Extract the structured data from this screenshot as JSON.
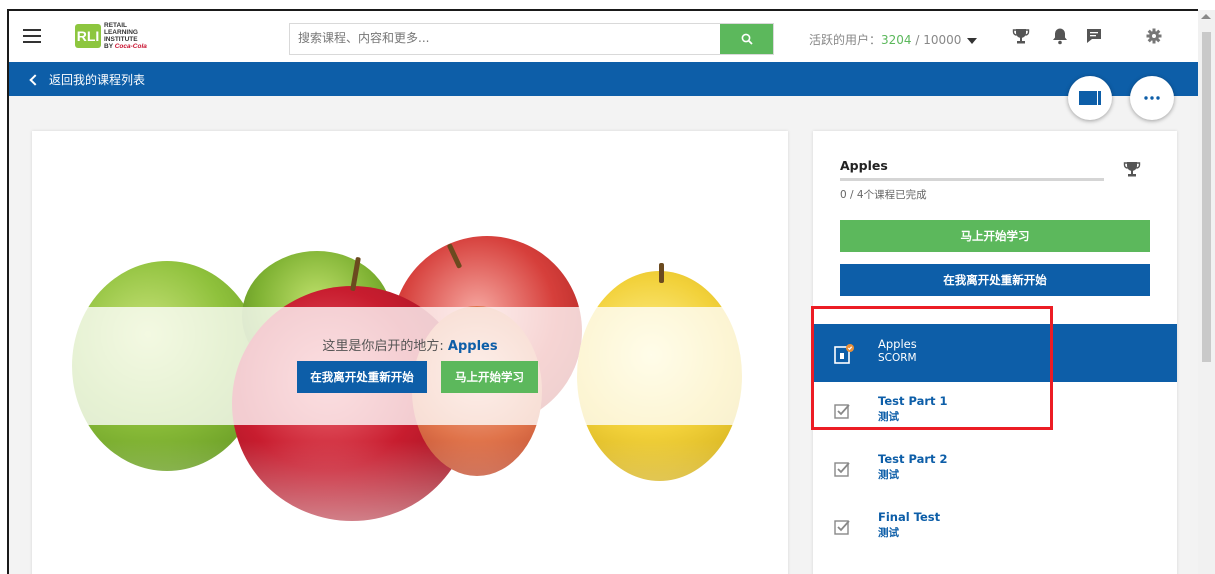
{
  "header": {
    "logo": {
      "line1": "RETAIL",
      "line2": "LEARNING",
      "line3": "INSTITUTE",
      "line4": "BY",
      "brand": "Coca-Cola",
      "mark": "RLI"
    },
    "search_placeholder": "搜索课程、内容和更多...",
    "active_users_label": "活跃的用户：",
    "active_users_count": "3204",
    "active_users_total": " / 10000",
    "icons": [
      "menu-icon",
      "search-icon",
      "trophy-icon",
      "bell-icon",
      "chat-icon",
      "gear-icon"
    ]
  },
  "nav": {
    "back_label": "返回我的课程列表"
  },
  "hero": {
    "title_prefix": "这里是你启开的地方: ",
    "title_course": "Apples",
    "restart_label": "在我离开处重新开始",
    "start_label": "马上开始学习"
  },
  "sidebar": {
    "course_name": "Apples",
    "progress": 0,
    "progress_text": "0 / 4个课程已完成",
    "start_label": "马上开始学习",
    "restart_label": "在我离开处重新开始",
    "items": [
      {
        "title": "Apples",
        "subtitle": "SCORM",
        "icon": "scorm-icon",
        "active": true
      },
      {
        "title": "Test Part 1",
        "subtitle": "测试",
        "icon": "checkbox-icon"
      },
      {
        "title": "Test Part 2",
        "subtitle": "测试",
        "icon": "checkbox-icon"
      },
      {
        "title": "Final Test",
        "subtitle": "测试",
        "icon": "checkbox-icon"
      }
    ]
  },
  "colors": {
    "primary": "#0d5ea8",
    "success": "#5cb85c",
    "highlight": "#ec1c24"
  }
}
